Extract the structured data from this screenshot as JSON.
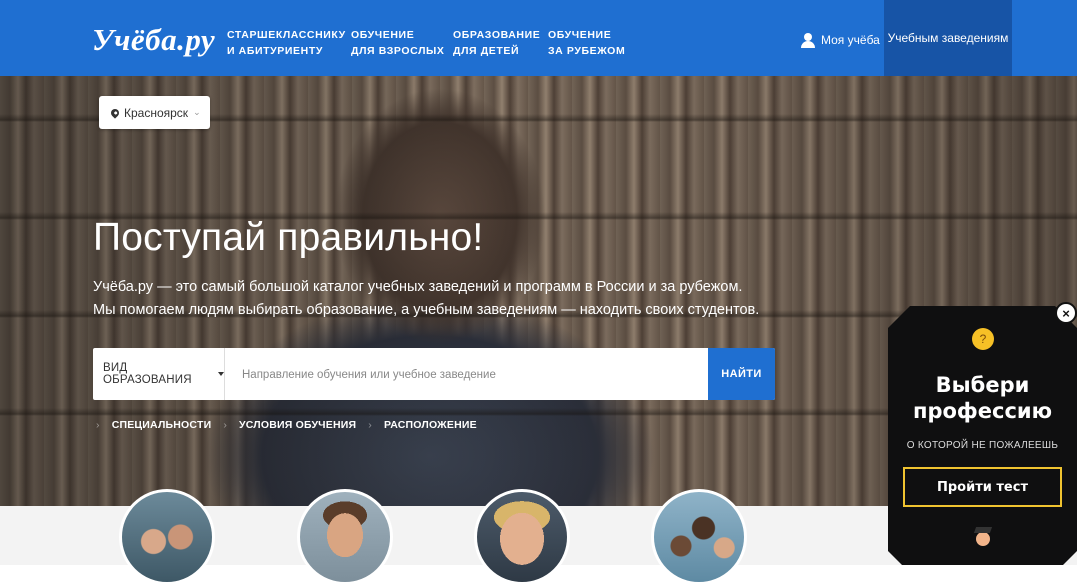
{
  "header": {
    "logo": "Учёба.ру",
    "nav": [
      {
        "line1": "СТАРШЕКЛАССНИКУ",
        "line2": "И АБИТУРИЕНТУ"
      },
      {
        "line1": "ОБУЧЕНИЕ",
        "line2": "ДЛЯ ВЗРОСЛЫХ"
      },
      {
        "line1": "ОБРАЗОВАНИЕ",
        "line2": "ДЛЯ ДЕТЕЙ"
      },
      {
        "line1": "ОБУЧЕНИЕ",
        "line2": "ЗА РУБЕЖОМ"
      }
    ],
    "my_ucheba": "Моя учёба",
    "for_schools": "Учебным заведениям"
  },
  "location": {
    "city": "Красноярск"
  },
  "hero": {
    "title": "Поступай правильно!",
    "text_line1": "Учёба.ру — это самый большой каталог учебных заведений и программ в России и за рубежом.",
    "text_line2": "Мы помогаем людям выбирать образование, а учебным заведениям — находить своих студентов."
  },
  "search": {
    "edu_type_label": "ВИД ОБРАЗОВАНИЯ",
    "placeholder": "Направление обучения или учебное заведение",
    "button": "НАЙТИ"
  },
  "filters": [
    "СПЕЦИАЛЬНОСТИ",
    "УСЛОВИЯ ОБУЧЕНИЯ",
    "РАСПОЛОЖЕНИЕ"
  ],
  "popup": {
    "close": "×",
    "title_line1": "Выбери",
    "title_line2": "профессию",
    "subtitle": "О КОТОРОЙ НЕ ПОЖАЛЕЕШЬ",
    "button": "Пройти тест"
  },
  "colors": {
    "brand_blue": "#1f6fd1",
    "header_dark": "#1754a6",
    "popup_bg": "#0f0f10",
    "popup_accent": "#f0c330"
  },
  "icons": [
    "user-icon",
    "pin-icon",
    "chevron-down-icon",
    "caret-down-icon",
    "close-icon",
    "thinking-face-icon",
    "graduate-icon"
  ]
}
